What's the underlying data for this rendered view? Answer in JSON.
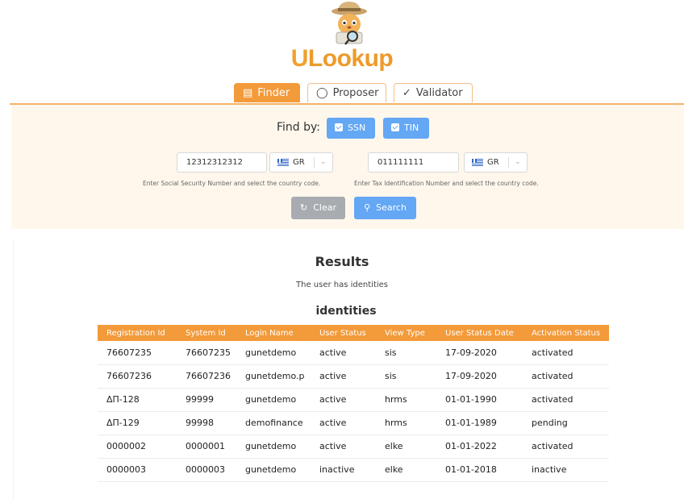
{
  "logo": {
    "text_u": "U",
    "text_rest": "Lookup"
  },
  "tabs": [
    {
      "label": "Finder",
      "icon": "document-search-icon",
      "active": true
    },
    {
      "label": "Proposer",
      "icon": "lightbulb-icon",
      "active": false
    },
    {
      "label": "Validator",
      "icon": "badge-check-icon",
      "active": false
    }
  ],
  "search": {
    "find_by_label": "Find by:",
    "ssn_label": "SSN",
    "tin_label": "TIN",
    "ssn_value": "12312312312",
    "ssn_country": "GR",
    "ssn_hint": "Enter Social Security Number and select the country code.",
    "tin_value": "011111111",
    "tin_country": "GR",
    "tin_hint": "Enter Tax Identification Number and select the country code.",
    "clear_label": "Clear",
    "search_label": "Search"
  },
  "results": {
    "title": "Results",
    "message": "The user has identities",
    "subtitle": "identities",
    "columns": [
      "Registration Id",
      "System Id",
      "Login Name",
      "User Status",
      "View Type",
      "User Status Date",
      "Activation Status"
    ],
    "rows": [
      [
        "76607235",
        "76607235",
        "gunetdemo",
        "active",
        "sis",
        "17-09-2020",
        "activated"
      ],
      [
        "76607236",
        "76607236",
        "gunetdemo.p",
        "active",
        "sis",
        "17-09-2020",
        "activated"
      ],
      [
        "ΔΠ-128",
        "99999",
        "gunetdemo",
        "active",
        "hrms",
        "01-01-1990",
        "activated"
      ],
      [
        "ΔΠ-129",
        "99998",
        "demofinance",
        "active",
        "hrms",
        "01-01-1989",
        "pending"
      ],
      [
        "0000002",
        "0000001",
        "gunetdemo",
        "active",
        "elke",
        "01-01-2022",
        "activated"
      ],
      [
        "0000003",
        "0000003",
        "gunetdemo",
        "inactive",
        "elke",
        "01-01-2018",
        "inactive"
      ]
    ]
  },
  "colors": {
    "accent": "#f39a3a",
    "primary": "#63a7f5",
    "panel_bg": "#fff7ec",
    "secondary": "#a8acb1"
  }
}
